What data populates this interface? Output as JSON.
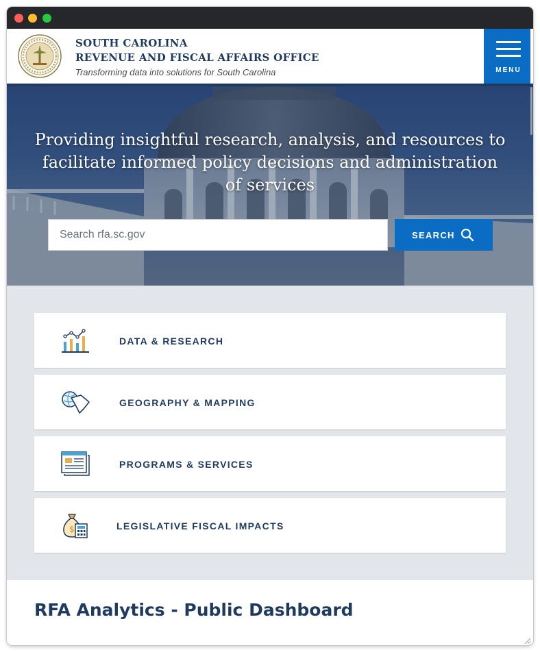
{
  "header": {
    "line1": "SOUTH CAROLINA",
    "line2": "REVENUE AND FISCAL AFFAIRS OFFICE",
    "tagline": "Transforming data into solutions for South Carolina",
    "menu_label": "MENU"
  },
  "hero": {
    "heading": "Providing insightful research, analysis, and resources to facilitate informed policy decisions and administration of services",
    "search_placeholder": "Search rfa.sc.gov",
    "search_button": "SEARCH"
  },
  "cards": [
    {
      "label": "DATA & RESEARCH",
      "icon": "chart-icon"
    },
    {
      "label": "GEOGRAPHY & MAPPING",
      "icon": "globe-map-icon"
    },
    {
      "label": "PROGRAMS & SERVICES",
      "icon": "document-icon"
    },
    {
      "label": "LEGISLATIVE FISCAL IMPACTS",
      "icon": "money-bag-calculator-icon"
    }
  ],
  "dashboard": {
    "title": "RFA Analytics - Public Dashboard"
  },
  "colors": {
    "brand_navy": "#1f3a5f",
    "accent_blue": "#0b6cc4",
    "card_bg": "#e2e5ea"
  }
}
